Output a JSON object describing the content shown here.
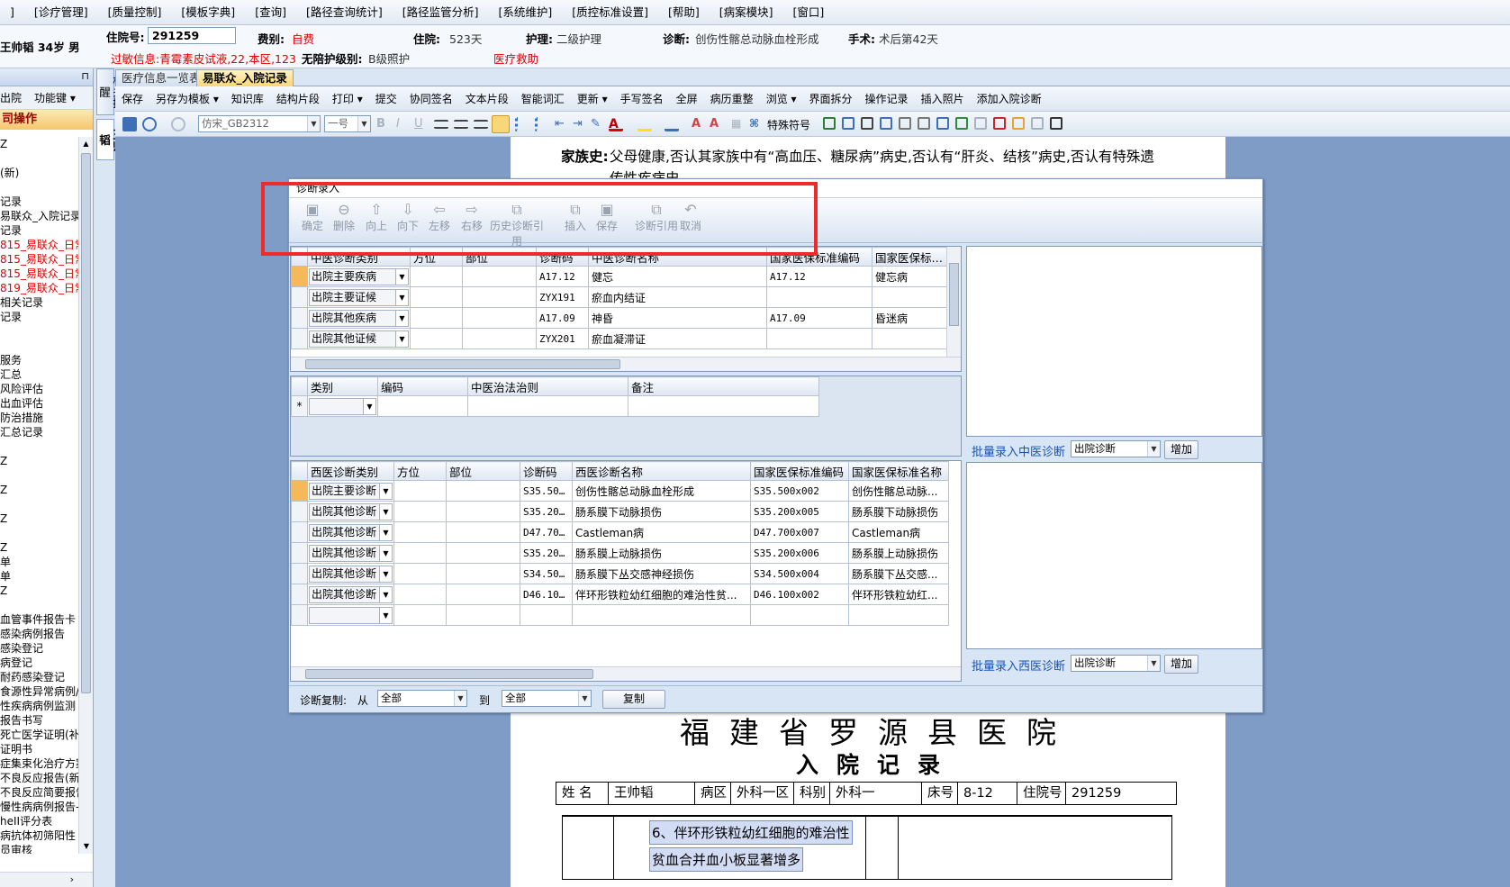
{
  "menu": [
    "]",
    "[诊疗管理]",
    "[质量控制]",
    "[模板字典]",
    "[查询]",
    "[路径查询统计]",
    "[路径监管分析]",
    "[系统维护]",
    "[质控标准设置]",
    "[帮助]",
    "[病案模块]",
    "[窗口]"
  ],
  "patient": {
    "name": "王帅韬 34岁 男",
    "inpatient_label": "住院号:",
    "inpatient_no": "291259",
    "fee_label": "费别:",
    "fee_value": "自费",
    "stay_label": "住院:",
    "stay_value": "523天",
    "nursing_label": "护理:",
    "nursing_value": "二级护理",
    "diagnosis_label": "诊断:",
    "diagnosis_value": "创伤性髂总动脉血栓形成",
    "surgery_label": "手术:",
    "surgery_value": "术后第42天",
    "allergy": "过敏信息:青霉素皮试液,22,本区,123",
    "no_escort_label": "无陪护级别:",
    "no_escort_value": "B级照护",
    "aid": "医疗救助"
  },
  "left_panel": {
    "pin": "⊓",
    "tools": [
      "出院",
      "功能键 ▾"
    ],
    "section": "司操作",
    "items": [
      {
        "text": "Z"
      },
      {
        "text": ""
      },
      {
        "text": "(新)"
      },
      {
        "text": ""
      },
      {
        "text": "记录"
      },
      {
        "text": "易联众_入院记录"
      },
      {
        "text": "记录"
      },
      {
        "text": "815_易联众_日常",
        "red": true
      },
      {
        "text": "815_易联众_日常",
        "red": true
      },
      {
        "text": "815_易联众_日常",
        "red": true
      },
      {
        "text": "819_易联众_日常",
        "red": true
      },
      {
        "text": "相关记录"
      },
      {
        "text": "记录"
      },
      {
        "text": ""
      },
      {
        "text": ""
      },
      {
        "text": "服务"
      },
      {
        "text": "汇总"
      },
      {
        "text": "风险评估"
      },
      {
        "text": "出血评估"
      },
      {
        "text": "防治措施"
      },
      {
        "text": "汇总记录"
      },
      {
        "text": ""
      },
      {
        "text": "Z"
      },
      {
        "text": ""
      },
      {
        "text": "Z"
      },
      {
        "text": ""
      },
      {
        "text": "Z"
      },
      {
        "text": ""
      },
      {
        "text": "Z"
      },
      {
        "text": "单"
      },
      {
        "text": "单"
      },
      {
        "text": "Z"
      },
      {
        "text": ""
      },
      {
        "text": "血管事件报告卡"
      },
      {
        "text": "感染病例报告"
      },
      {
        "text": "感染登记"
      },
      {
        "text": "病登记"
      },
      {
        "text": "耐药感染登记"
      },
      {
        "text": "食源性异常病例/"
      },
      {
        "text": "性疾病病例监测"
      },
      {
        "text": "报告书写"
      },
      {
        "text": "死亡医学证明(补"
      },
      {
        "text": "证明书"
      },
      {
        "text": "症集束化治疗方案"
      },
      {
        "text": "不良反应报告(新"
      },
      {
        "text": "不良反应简要报告"
      },
      {
        "text": "慢性病病例报告-"
      },
      {
        "text": "heII评分表"
      },
      {
        "text": "病抗体初筛阳性"
      },
      {
        "text": "员审核"
      },
      {
        "text": "Z"
      }
    ]
  },
  "side_tabs": [
    "相关提醒",
    "王帅韬"
  ],
  "doc_tabs": [
    "医疗信息一览表",
    "易联众_入院记录"
  ],
  "toolbar1": [
    "保存",
    "另存为模板 ▾",
    "知识库",
    "结构片段",
    "打印 ▾",
    "提交",
    "协同签名",
    "文本片段",
    "智能词汇",
    "更新 ▾",
    "手写签名",
    "全屏",
    "病历重整",
    "浏览 ▾",
    "界面拆分",
    "操作记录",
    "插入照片",
    "添加入院诊断"
  ],
  "toolbar2": {
    "font": "仿宋_GB2312",
    "size": "一号",
    "special": "特殊符号"
  },
  "document": {
    "family_label": "家族史:",
    "family_text": "父母健康,否认其家族中有“高血压、糖尿病”病史,否认有“肝炎、结核”病史,否认有特殊遗",
    "family_text2": "传性疾病史。",
    "hospital": "福建省罗源县医院",
    "record_title": "入院记录",
    "info": [
      {
        "label": "姓 名",
        "value": "王帅韬"
      },
      {
        "label": "病区",
        "value": "外科一区"
      },
      {
        "label": "科别",
        "value": "外科一"
      },
      {
        "label": "床号",
        "value": "8-12"
      },
      {
        "label": "住院号",
        "value": "291259"
      }
    ],
    "diag_line1": "6、伴环形铁粒幼红细胞的难治性",
    "diag_line2": "贫血合并血小板显著增多"
  },
  "dialog": {
    "title": "诊断录入",
    "toolbar": [
      {
        "label": "确定",
        "icon": "save-icon",
        "glyph": "▣"
      },
      {
        "label": "删除",
        "icon": "delete-icon",
        "glyph": "⊖"
      },
      {
        "label": "向上",
        "icon": "arrow-up-icon",
        "glyph": "⇧"
      },
      {
        "label": "向下",
        "icon": "arrow-down-icon",
        "glyph": "⇩"
      },
      {
        "label": "左移",
        "icon": "arrow-left-icon",
        "glyph": "⇦"
      },
      {
        "label": "右移",
        "icon": "arrow-right-icon",
        "glyph": "⇨"
      },
      {
        "label": "历史诊断引用",
        "icon": "history-icon",
        "glyph": "⧉"
      },
      {
        "label": "插入",
        "icon": "insert-icon",
        "glyph": "⧉"
      },
      {
        "label": "保存",
        "icon": "save-icon",
        "glyph": "▣"
      },
      {
        "label": "诊断引用",
        "icon": "quote-icon",
        "glyph": "⧉"
      },
      {
        "label": "取消",
        "icon": "undo-icon",
        "glyph": "↶"
      }
    ],
    "tcm_columns": [
      "中医诊断类别",
      "方位",
      "部位",
      "诊断码",
      "中医诊断名称",
      "国家医保标准编码",
      "国家医保标准名"
    ],
    "tcm_rows": [
      {
        "type": "出院主要疾病",
        "code": "A17.12",
        "name": "健忘",
        "ins_code": "A17.12",
        "ins_name": "健忘病",
        "sel": true
      },
      {
        "type": "出院主要证候",
        "code": "ZYX191",
        "name": "瘀血内结证",
        "ins_code": "",
        "ins_name": ""
      },
      {
        "type": "出院其他疾病",
        "code": "A17.09",
        "name": "神昏",
        "ins_code": "A17.09",
        "ins_name": "昏迷病"
      },
      {
        "type": "出院其他证候",
        "code": "ZYX201",
        "name": "瘀血凝滞证",
        "ins_code": "",
        "ins_name": ""
      }
    ],
    "treat_columns": [
      "类别",
      "编码",
      "中医治法治则",
      "备注"
    ],
    "treat_new_row": "*",
    "wm_columns": [
      "西医诊断类别",
      "方位",
      "部位",
      "诊断码",
      "西医诊断名称",
      "国家医保标准编码",
      "国家医保标准名称"
    ],
    "wm_rows": [
      {
        "type": "出院主要诊断",
        "code": "S35.50...",
        "name": "创伤性髂总动脉血栓形成",
        "ins_code": "S35.500x002",
        "ins_name": "创伤性髂总动脉...",
        "sel": true
      },
      {
        "type": "出院其他诊断",
        "code": "S35.20...",
        "name": "肠系膜下动脉损伤",
        "ins_code": "S35.200x005",
        "ins_name": "肠系膜下动脉损伤"
      },
      {
        "type": "出院其他诊断",
        "code": "D47.70...",
        "name": "Castleman病",
        "ins_code": "D47.700x007",
        "ins_name": "Castleman病"
      },
      {
        "type": "出院其他诊断",
        "code": "S35.20...",
        "name": "肠系膜上动脉损伤",
        "ins_code": "S35.200x006",
        "ins_name": "肠系膜上动脉损伤"
      },
      {
        "type": "出院其他诊断",
        "code": "S34.50...",
        "name": "肠系膜下丛交感神经损伤",
        "ins_code": "S34.500x004",
        "ins_name": "肠系膜下丛交感..."
      },
      {
        "type": "出院其他诊断",
        "code": "D46.10...",
        "name": "伴环形铁粒幼红细胞的难治性贫...",
        "ins_code": "D46.100x002",
        "ins_name": "伴环形铁粒幼红..."
      }
    ],
    "batch_tcm": {
      "label": "批量录入中医诊断",
      "select": "出院诊断",
      "button": "增加"
    },
    "batch_wm": {
      "label": "批量录入西医诊断",
      "select": "出院诊断",
      "button": "增加"
    },
    "copy": {
      "label": "诊断复制:",
      "from_label": "从",
      "from": "全部",
      "to_label": "到",
      "to": "全部",
      "button": "复制"
    }
  },
  "colors": {
    "highlight": "#ee2a2a",
    "selected_row": "#f6b95a",
    "doc_bg": "#7f9cc7"
  }
}
